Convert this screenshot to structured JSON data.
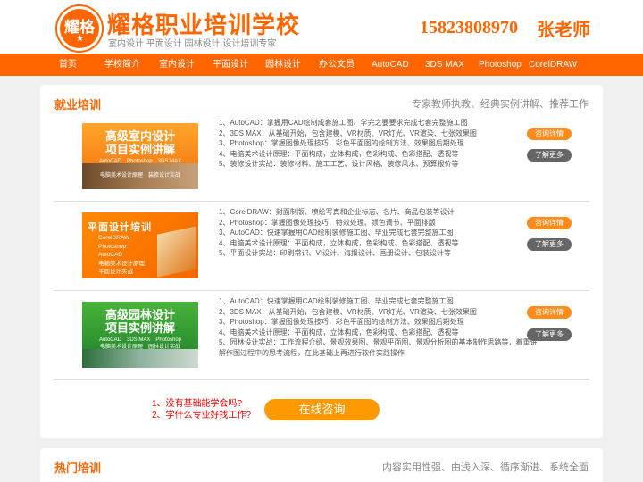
{
  "header": {
    "logo_text": "耀格",
    "logo_stars": "★",
    "site_title": "耀格职业培训学校",
    "site_sub": "室内设计 平面设计 园林设计 设计培训专家",
    "phone": "15823808970",
    "teacher": "张老师"
  },
  "nav": [
    "首页",
    "学校简介",
    "室内设计",
    "平面设计",
    "园林设计",
    "办公文员",
    "AutoCAD",
    "3DS MAX",
    "Photoshop",
    "CorelDRAW"
  ],
  "section1": {
    "title": "就业培训",
    "slogan": "专家教师执教、经典实例讲解、推荐工作",
    "courses": [
      {
        "banner": {
          "t1": "高级室内设计",
          "t2": "项目实例讲解",
          "software": "AutoCAD　Photoshop　3DS MAX",
          "bottom": "电脑美术设计原理　装修设计实战"
        },
        "items": [
          "1、AutoCAD：掌握用CAD绘制成套施工图、学完之要要求完成七套完整施工图",
          "2、3DS MAX：从基础开始，包含建模、VR材质、VR灯光、VR渲染、七张效果图",
          "3、Photoshop：掌握图像处理技巧，彩色平面图的绘制方法、效果图后期处理",
          "4、电脑美术设计原理：平面构成，立体构成，色彩构成、色彩搭配、透视等",
          "5、装修设计实战：装修材料、施工工艺、设计风格、装修风水、预算报价等"
        ]
      },
      {
        "banner": {
          "title": "平面设计培训",
          "list": [
            "CorelDRAW",
            "Photoshop",
            "AutoCAD",
            "电脑美术设计原理",
            "平面设计实战"
          ]
        },
        "items": [
          "1、CorelDRAW：封面制版、喷绘写真和企业标志、名片、商品包装等设计",
          "2、Photoshop：掌握图像处理技巧，特效处理、颜色调节、平面排版",
          "3、AutoCAD：快速掌握用CAD绘制装修施工图、毕业完成七套完整施工图",
          "4、电脑美术设计原理：平面构成，立体构成，色彩构成、色彩搭配、透视等",
          "5、平面设计实战：印刷常识、VI设计、海报设计、画册设计、包装设计等"
        ]
      },
      {
        "banner": {
          "t1": "高级园林设计",
          "t2": "项目实例讲解",
          "software": "AutoCAD　3DS MAX　Photoshop",
          "bottom": "电脑美术设计原理　园林设计实战"
        },
        "items": [
          "1、AutoCAD：快速掌握用CAD绘制装修施工图、毕业完成七套完整施工图",
          "2、3DS MAX：从基础开始，包含建模、VR材质、VR灯光、VR渲染、七张效果图",
          "3、Photoshop：掌握图像处理技巧，彩色平面图的绘制方法、效果图后期处理",
          "4、电脑美术设计原理：平面构成，立体构成，色彩构成、色彩搭配、透视等",
          "5、园林设计实战：工作流程介绍、景观效果图、景观平面图、景观分析图的基本制作思路等，着重讲解作图过程中的思考流程，在此基础上再进行软件实践操作"
        ]
      }
    ],
    "btn_consult": "咨询详情",
    "btn_more": "了解更多",
    "faq": [
      "1、没有基础能学会吗?",
      "2、学什么专业好找工作?"
    ],
    "online_btn": "在线咨询"
  },
  "section2": {
    "title": "热门培训",
    "slogan": "内容实用性强、由浅入深、循序渐进、系统全面"
  },
  "colors": {
    "accent": "#ff6600",
    "button": "#ff8c1a",
    "button_gray": "#666666",
    "faq": "#e60000"
  }
}
